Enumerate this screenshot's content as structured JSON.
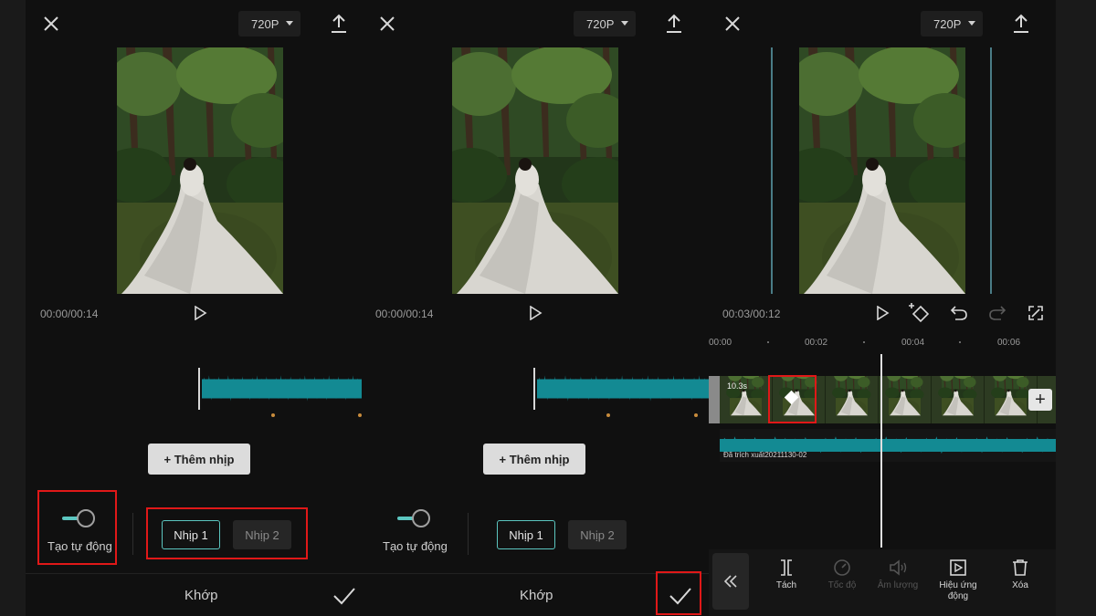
{
  "panels": [
    {
      "resolution": "720P",
      "timecode": "00:00/00:14",
      "add_beat_label": "+ Thêm nhịp",
      "auto_toggle_label": "Tạo tự động",
      "beat_1_label": "Nhịp 1",
      "beat_2_label": "Nhịp 2",
      "match_label": "Khớp"
    },
    {
      "resolution": "720P",
      "timecode": "00:00/00:14",
      "add_beat_label": "+ Thêm nhịp",
      "auto_toggle_label": "Tạo tự động",
      "beat_1_label": "Nhịp 1",
      "beat_2_label": "Nhịp 2",
      "match_label": "Khớp"
    },
    {
      "resolution": "720P",
      "timecode": "00:03/00:12",
      "ruler": [
        "00:00",
        "00:02",
        "00:04",
        "00:06"
      ],
      "clip_duration": "10.3s",
      "audio_track_name": "Đã trích xuất20211130-02",
      "tools": {
        "split": "Tách",
        "speed": "Tốc độ",
        "volume": "Âm lượng",
        "effects": "Hiệu ứng động",
        "delete": "Xóa"
      }
    }
  ],
  "colors": {
    "accent": "#5cc6c0",
    "waveform": "#138a93",
    "highlight": "#e01818",
    "panel_bg": "#101010"
  },
  "icons": [
    "close-icon",
    "export-icon",
    "play-icon",
    "keyframe-icon",
    "undo-icon",
    "redo-icon",
    "fullscreen-icon",
    "check-icon",
    "chevron-left-double-icon",
    "split-icon",
    "speed-icon",
    "volume-icon",
    "effects-icon",
    "trash-icon"
  ]
}
